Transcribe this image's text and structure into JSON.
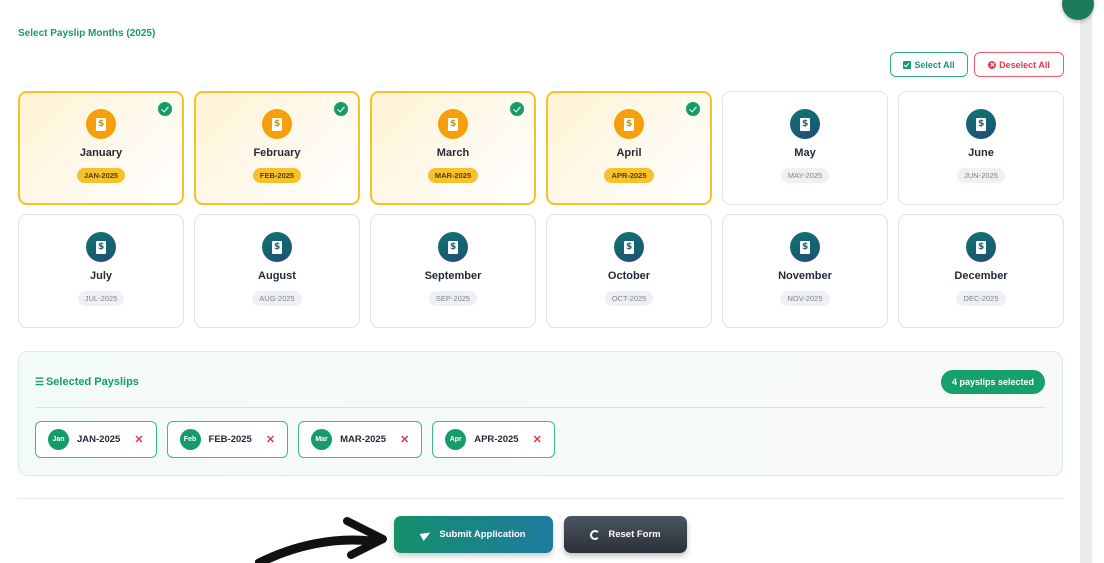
{
  "section_title": "Select Payslip Months (2025)",
  "controls": {
    "select_all_label": "Select All",
    "deselect_all_label": "Deselect All"
  },
  "months": [
    {
      "name": "January",
      "code": "JAN-2025",
      "selected": true
    },
    {
      "name": "February",
      "code": "FEB-2025",
      "selected": true
    },
    {
      "name": "March",
      "code": "MAR-2025",
      "selected": true
    },
    {
      "name": "April",
      "code": "APR-2025",
      "selected": true
    },
    {
      "name": "May",
      "code": "MAY-2025",
      "selected": false
    },
    {
      "name": "June",
      "code": "JUN-2025",
      "selected": false
    },
    {
      "name": "July",
      "code": "JUL-2025",
      "selected": false
    },
    {
      "name": "August",
      "code": "AUG-2025",
      "selected": false
    },
    {
      "name": "September",
      "code": "SEP-2025",
      "selected": false
    },
    {
      "name": "October",
      "code": "OCT-2025",
      "selected": false
    },
    {
      "name": "November",
      "code": "NOV-2025",
      "selected": false
    },
    {
      "name": "December",
      "code": "DEC-2025",
      "selected": false
    }
  ],
  "selected_panel": {
    "title": "Selected Payslips",
    "count_label": "4 payslips selected",
    "chips": [
      {
        "avatar": "Jan",
        "label": "JAN-2025"
      },
      {
        "avatar": "Feb",
        "label": "FEB-2025"
      },
      {
        "avatar": "Mar",
        "label": "MAR-2025"
      },
      {
        "avatar": "Apr",
        "label": "APR-2025"
      }
    ],
    "remove_glyph": "✕"
  },
  "actions": {
    "submit_label": "Submit Application",
    "reset_label": "Reset Form"
  },
  "colors": {
    "accent_green": "#169c6a",
    "selected_gold": "#f6c229",
    "danger_red": "#e23b4c",
    "icon_teal": "#0f766e"
  },
  "icons": {
    "month_icon": "payslip-document-icon",
    "selected_badge": "check-circle-icon",
    "submit_icon": "send-icon",
    "reset_icon": "redo-icon"
  }
}
